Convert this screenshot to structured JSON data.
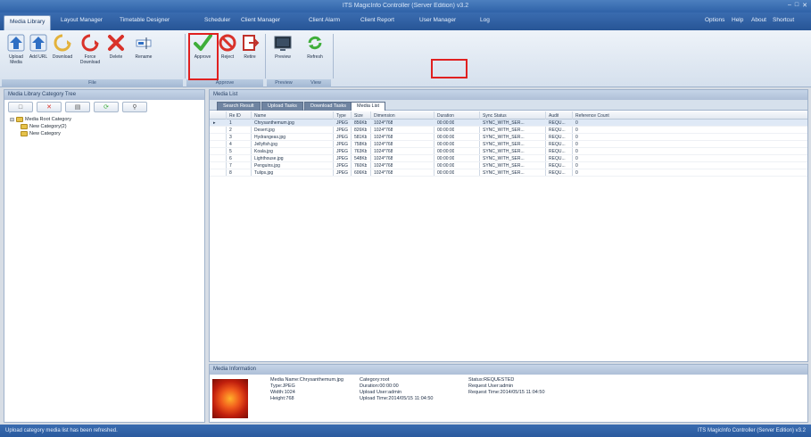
{
  "window": {
    "title": "ITS MagicInfo Controller (Server Edition) v3.2",
    "controls": [
      "–",
      "□",
      "✕"
    ]
  },
  "menu": {
    "items": [
      "Media Library",
      "Layout Manager",
      "Timetable Designer",
      "Scheduler",
      "Client Manager",
      "Client Alarm",
      "Client Report",
      "User Manager",
      "Log"
    ],
    "right_items": [
      "Options",
      "Help",
      "About",
      "Shortcut"
    ]
  },
  "ribbon": {
    "file_group": "File",
    "approve_group": "Approve",
    "preview_group": "Preview",
    "view_group": "View",
    "buttons": {
      "upload_media": "Upload Media",
      "add_url": "Add URL",
      "download": "Download",
      "force_download": "Force Download",
      "delete": "Delete",
      "rename": "Rename",
      "approve": "Approve",
      "reject": "Reject",
      "retire": "Retire",
      "preview": "Preview",
      "refresh": "Refresh"
    }
  },
  "left_panel": {
    "title": "Media Library Category Tree",
    "tree": {
      "root": "Media Root Category",
      "children": [
        "New Category(2)",
        "New Category"
      ]
    }
  },
  "right_panel": {
    "title": "Media List",
    "tabs": [
      "Search Result",
      "Upload Tasks",
      "Download Tasks",
      "Media List"
    ],
    "columns": [
      "Re ID",
      "Name",
      "Type",
      "Size",
      "Dimension",
      "Duration",
      "Sync Status",
      "Audit",
      "Reference Count"
    ],
    "rows": [
      [
        "1",
        "Chrysanthemum.jpg",
        "JPEG",
        "856Kb",
        "1024*768",
        "00:00:00",
        "SYNC_WITH_SER...",
        "REQU...",
        "0"
      ],
      [
        "2",
        "Desert.jpg",
        "JPEG",
        "826Kb",
        "1024*768",
        "00:00:00",
        "SYNC_WITH_SER...",
        "REQU...",
        "0"
      ],
      [
        "3",
        "Hydrangeas.jpg",
        "JPEG",
        "581Kb",
        "1024*768",
        "00:00:00",
        "SYNC_WITH_SER...",
        "REQU...",
        "0"
      ],
      [
        "4",
        "Jellyfish.jpg",
        "JPEG",
        "758Kb",
        "1024*768",
        "00:00:00",
        "SYNC_WITH_SER...",
        "REQU...",
        "0"
      ],
      [
        "5",
        "Koala.jpg",
        "JPEG",
        "763Kb",
        "1024*768",
        "00:00:00",
        "SYNC_WITH_SER...",
        "REQU...",
        "0"
      ],
      [
        "6",
        "Lighthouse.jpg",
        "JPEG",
        "548Kb",
        "1024*768",
        "00:00:00",
        "SYNC_WITH_SER...",
        "REQU...",
        "0"
      ],
      [
        "7",
        "Penguins.jpg",
        "JPEG",
        "760Kb",
        "1024*768",
        "00:00:00",
        "SYNC_WITH_SER...",
        "REQU...",
        "0"
      ],
      [
        "8",
        "Tulips.jpg",
        "JPEG",
        "606Kb",
        "1024*768",
        "00:00:00",
        "SYNC_WITH_SER...",
        "REQU...",
        "0"
      ]
    ]
  },
  "media_info": {
    "title": "Media Information",
    "media_name": "Media Name:Chrysanthemum.jpg",
    "type": "Type:JPEG",
    "width": "Width:1024",
    "height": "Height:768",
    "category": "Category:root",
    "duration": "Duration:00:00:00",
    "upload_user": "Upload User:admin",
    "upload_time": "Upload Time:2014/05/15 11:04:50",
    "status": "Status:REQUESTED",
    "request_user": "Request User:admin",
    "request_time": "Request Time:2014/05/15 11:04:50"
  },
  "status_bar": {
    "message": "Upload category media list has been refreshed.",
    "edition": "ITS MagicInfo Controller (Server Edition) v3.2"
  },
  "colors": {
    "accent": "#2f62a8",
    "highlight": "#e02020"
  }
}
